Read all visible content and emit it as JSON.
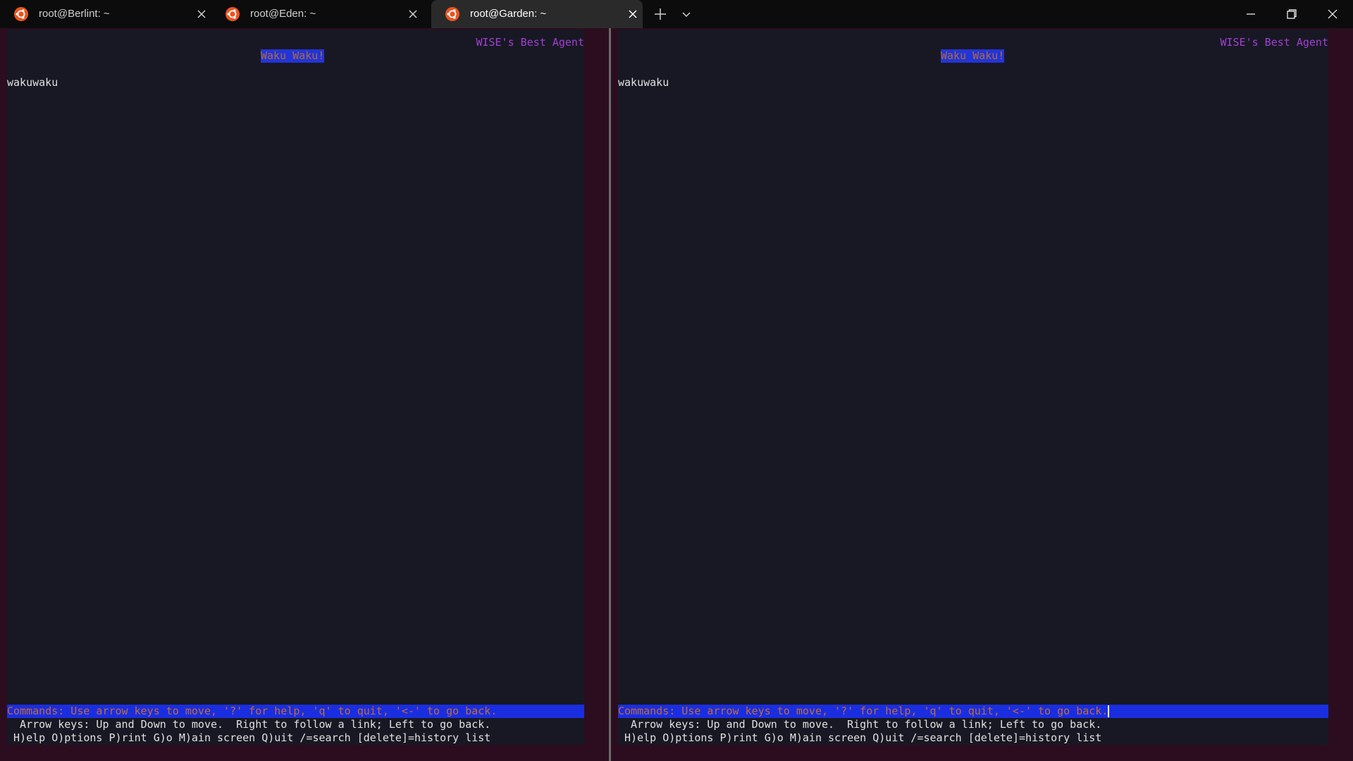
{
  "tabs": [
    {
      "label": "root@Berlint: ~",
      "icon": "ubuntu-icon",
      "active": false
    },
    {
      "label": "root@Eden: ~",
      "icon": "ubuntu-icon",
      "active": false
    },
    {
      "label": "root@Garden: ~",
      "icon": "ubuntu-icon",
      "active": true
    }
  ],
  "window_controls": {
    "minimize": "minimize-icon",
    "restore": "restore-icon",
    "close": "close-icon"
  },
  "colors": {
    "terminal_bg": "#181824",
    "pane_border": "#2c0d1f",
    "highlight_bg": "#1a2ee0",
    "highlight_fg": "#c06a3a",
    "agent_label": "#a040d0",
    "ubuntu_orange": "#e95420"
  },
  "left_pane": {
    "agent_label": "WISE's Best Agent",
    "title": "Waku Waku!",
    "body": "wakuwaku",
    "commands": "Commands: Use arrow keys to move, '?' for help, 'q' to quit, '<-' to go back.",
    "help_line1": "  Arrow keys: Up and Down to move.  Right to follow a link; Left to go back.",
    "help_line2": " H)elp O)ptions P)rint G)o M)ain screen Q)uit /=search [delete]=history list"
  },
  "right_pane": {
    "agent_label": "WISE's Best Agent",
    "title": "Waku Waku!",
    "body": "wakuwaku",
    "commands": "Commands: Use arrow keys to move, '?' for help, 'q' to quit, '<-' to go back.",
    "help_line1": "  Arrow keys: Up and Down to move.  Right to follow a link; Left to go back.",
    "help_line2": " H)elp O)ptions P)rint G)o M)ain screen Q)uit /=search [delete]=history list"
  }
}
